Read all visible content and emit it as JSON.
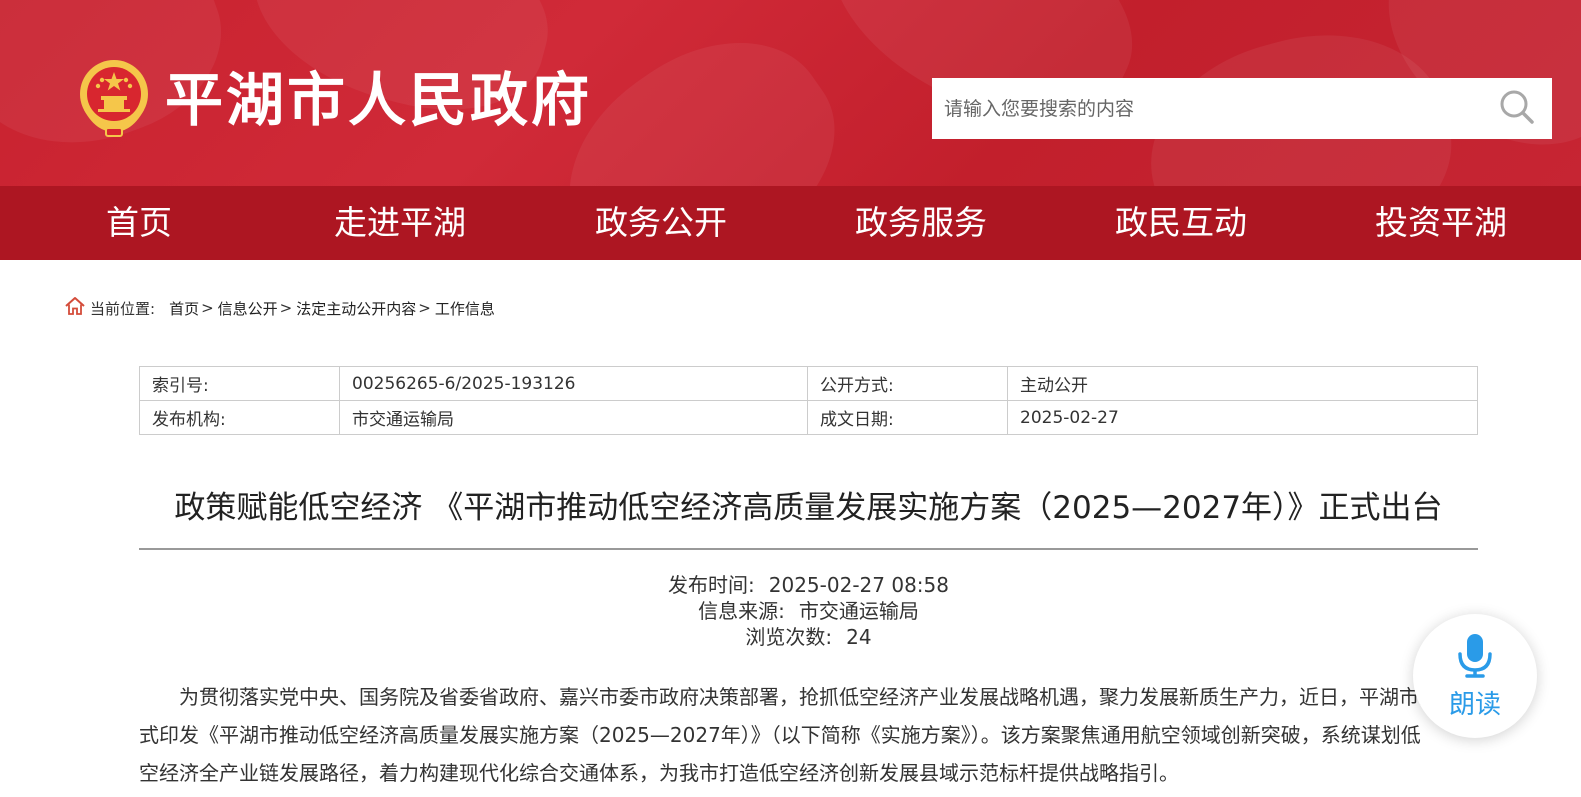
{
  "site": {
    "title": "平湖市人民政府",
    "brand_color": "#c8222f",
    "nav_color": "#ad1622"
  },
  "search": {
    "placeholder": "请输入您要搜索的内容",
    "icon": "search-icon"
  },
  "nav": {
    "items": [
      {
        "label": "首页"
      },
      {
        "label": "走进平湖"
      },
      {
        "label": "政务公开"
      },
      {
        "label": "政务服务"
      },
      {
        "label": "政民互动"
      },
      {
        "label": "投资平湖"
      }
    ]
  },
  "breadcrumb": {
    "icon": "home-icon",
    "label": "当前位置:",
    "items": [
      "首页",
      "信息公开",
      "法定主动公开内容",
      "工作信息"
    ],
    "separator": ">"
  },
  "info": {
    "rows": [
      [
        {
          "key": "索引号:",
          "value": "00256265-6/2025-193126"
        },
        {
          "key": "公开方式:",
          "value": "主动公开"
        }
      ],
      [
        {
          "key": "发布机构:",
          "value": "市交通运输局"
        },
        {
          "key": "成文日期:",
          "value": "2025-02-27"
        }
      ]
    ]
  },
  "article": {
    "title": "政策赋能低空经济 《平湖市推动低空经济高质量发展实施方案（2025—2027年）》正式出台",
    "meta": {
      "publish_label": "发布时间:",
      "publish_value": "2025-02-27 08:58",
      "source_label": "信息来源:",
      "source_value": "市交通运输局",
      "views_label": "浏览次数:",
      "views_value": "24"
    },
    "body": "为贯彻落实党中央、国务院及省委省政府、嘉兴市委市政府决策部署，抢抓低空经济产业发展战略机遇，聚力发展新质生产力，近日，平湖市正式印发《平湖市推动低空经济高质量发展实施方案（2025—2027年）》（以下简称《实施方案》）。该方案聚焦通用航空领域创新突破，系统谋划低空经济全产业链发展路径，着力构建现代化综合交通体系，为我市打造低空经济创新发展县域示范标杆提供战略指引。"
  },
  "read_aloud": {
    "label": "朗读",
    "icon": "microphone-icon",
    "color": "#2a9be8"
  }
}
